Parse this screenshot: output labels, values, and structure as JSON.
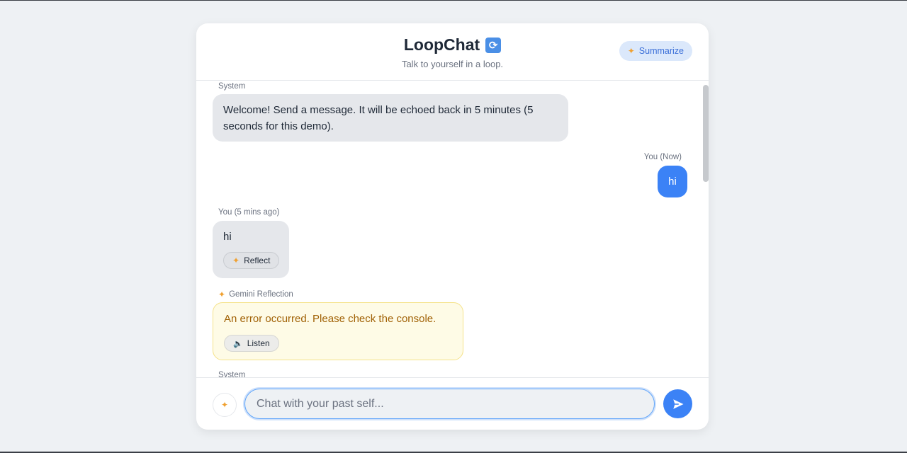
{
  "header": {
    "title": "LoopChat",
    "title_icon": "loop-arrows-icon",
    "subtitle": "Talk to yourself in a loop.",
    "summarize_label": "Summarize"
  },
  "messages": [
    {
      "sender": "System",
      "text": "Welcome! Send a message. It will be echoed back in 5 minutes (5 seconds for this demo)."
    },
    {
      "sender": "You (Now)",
      "text": "hi"
    },
    {
      "sender": "You (5 mins ago)",
      "text": "hi",
      "action_label": "Reflect"
    },
    {
      "sender": "Gemini Reflection",
      "text": "An error occurred. Please check the console.",
      "action_label": "Listen"
    },
    {
      "sender": "System"
    }
  ],
  "composer": {
    "placeholder": "Chat with your past self...",
    "value": ""
  },
  "colors": {
    "accent": "#3b82f6",
    "system_bubble": "#e5e7eb",
    "reflection_bubble": "#fefbe6",
    "reflection_text": "#a16207",
    "page_background": "#eef1f4"
  }
}
